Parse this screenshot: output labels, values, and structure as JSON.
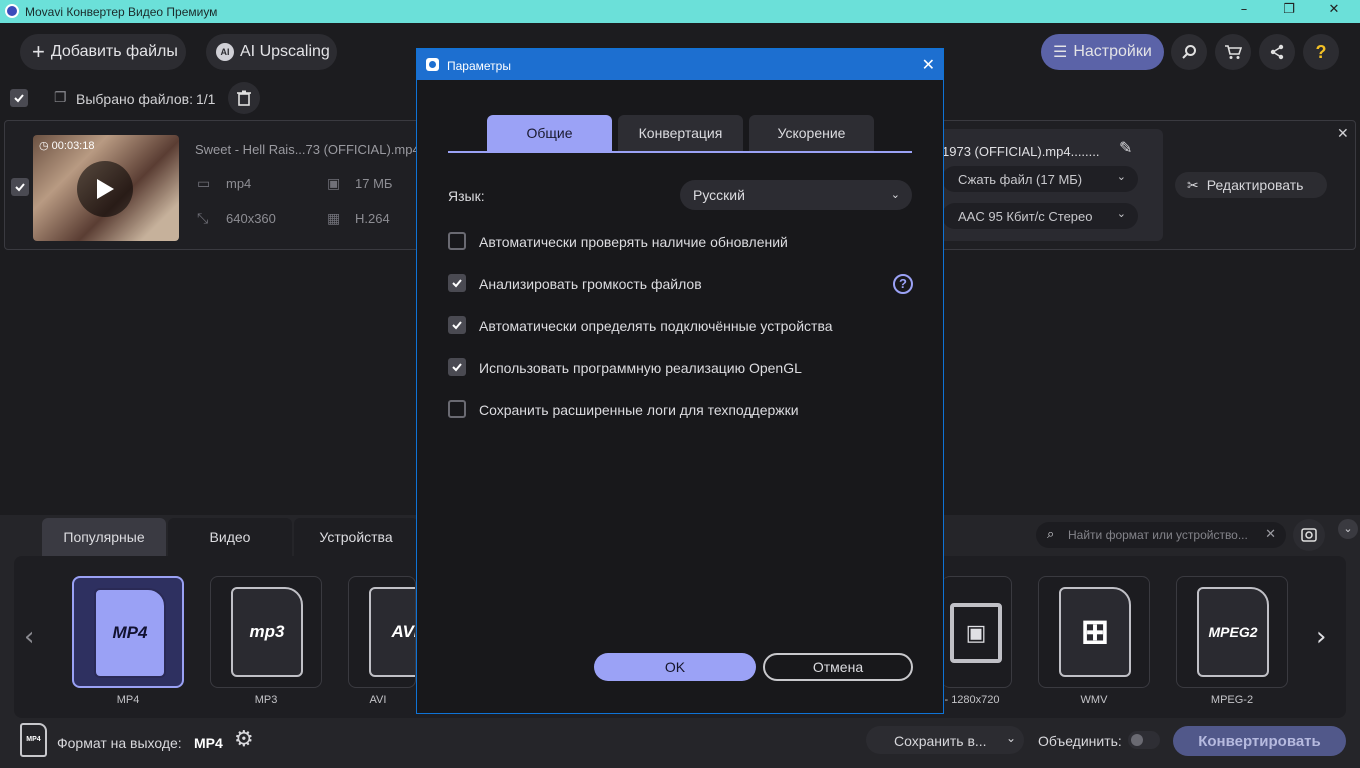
{
  "window": {
    "title": "Movavi Конвертер Видео Премиум",
    "controls": [
      "–",
      "❐",
      "✕"
    ]
  },
  "toolbar": {
    "add_files": "Добавить файлы",
    "ai_upscaling": "AI Upscaling",
    "settings": "Настройки",
    "help_icon_glyph": "?"
  },
  "file_list": {
    "selected_label": "Выбрано файлов:",
    "selected_count": "1/1",
    "file": {
      "duration": "00:03:18",
      "name": "Sweet - Hell Rais...73 (OFFICIAL).mp4",
      "container": "mp4",
      "size": "17 МБ",
      "resolution": "640x360",
      "codec": "H.264",
      "output_name": "1973 (OFFICIAL).mp4........",
      "compress": "Сжать файл (17 МБ)",
      "audio": "AAC 95 Кбит/с Стерео",
      "edit": "Редактировать"
    }
  },
  "format_panel": {
    "tabs": [
      "Популярные",
      "Видео",
      "Устройства"
    ],
    "active_tab": 0,
    "search_placeholder": "Найти формат или устройство...",
    "formats": [
      {
        "label": "MP4",
        "badge": "MP4",
        "selected": true
      },
      {
        "label": "MP3",
        "badge": "mp3",
        "selected": false
      },
      {
        "label": "AVI",
        "badge": "AVI",
        "selected": false
      },
      {
        "label": "- 1280x720",
        "badge": "",
        "selected": false
      },
      {
        "label": "WMV",
        "badge": "",
        "selected": false
      },
      {
        "label": "MPEG-2",
        "badge": "MPEG2",
        "selected": false
      }
    ]
  },
  "bottom": {
    "output_format_label": "Формат на выходе:",
    "output_format_value": "MP4",
    "save_to": "Сохранить в...",
    "merge_label": "Объединить:",
    "convert": "Конвертировать"
  },
  "dialog": {
    "title": "Параметры",
    "tabs": [
      "Общие",
      "Конвертация",
      "Ускорение"
    ],
    "active_tab": 0,
    "language_label": "Язык:",
    "language_value": "Русский",
    "options": [
      {
        "label": "Автоматически проверять наличие обновлений",
        "checked": false
      },
      {
        "label": "Анализировать громкость файлов",
        "checked": true
      },
      {
        "label": "Автоматически определять подключённые устройства",
        "checked": true
      },
      {
        "label": "Использовать программную реализацию OpenGL",
        "checked": true
      },
      {
        "label": "Сохранить расширенные логи для техподдержки",
        "checked": false
      }
    ],
    "ok": "OK",
    "cancel": "Отмена"
  },
  "colors": {
    "accent": "#9ba2f6",
    "titlebar": "#6be0d9",
    "dialog_title": "#1d6fd0"
  }
}
